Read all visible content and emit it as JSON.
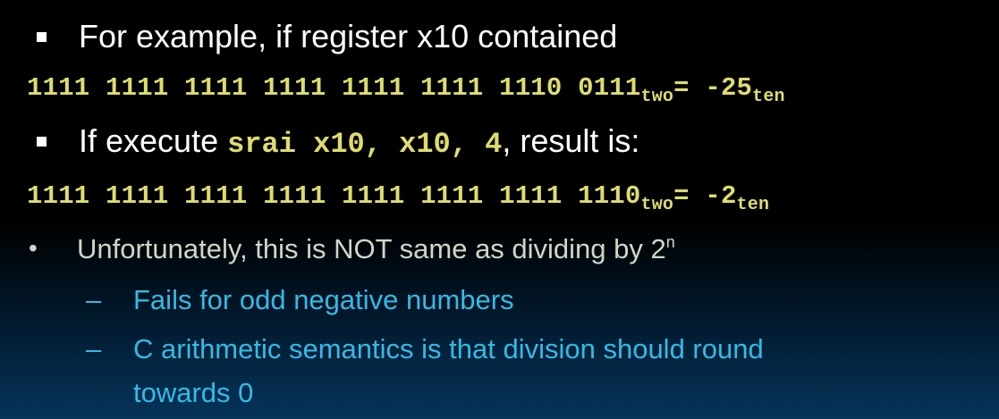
{
  "slide": {
    "bullet1": {
      "text": "For example, if register x10 contained"
    },
    "binary1": {
      "bits": "1111 1111 1111 1111 1111 1111 1110 0111",
      "base_sub": "two",
      "equals": "= ",
      "value": "-25",
      "value_sub": "ten"
    },
    "bullet2": {
      "prefix": "If execute ",
      "code": "srai x10, x10, 4",
      "suffix": ", result is:"
    },
    "binary2": {
      "bits": "1111 1111 1111 1111 1111 1111 1111 1110",
      "base_sub": "two",
      "equals": "= ",
      "value": "-2",
      "value_sub": "ten"
    },
    "bullet3": {
      "marker": "•",
      "text": "Unfortunately, this is NOT same as dividing by 2",
      "superscript": "n"
    },
    "sub_bullets": [
      {
        "marker": "–",
        "text": "Fails for odd negative numbers"
      },
      {
        "marker": "–",
        "line1": "C arithmetic semantics is that division should round",
        "line2": "towards 0"
      }
    ],
    "colors": {
      "code": "#dedc6e",
      "body_text": "#cdd8c8",
      "sub_bullet_text": "#33bbe6",
      "heading_text": "#ffffff"
    }
  }
}
